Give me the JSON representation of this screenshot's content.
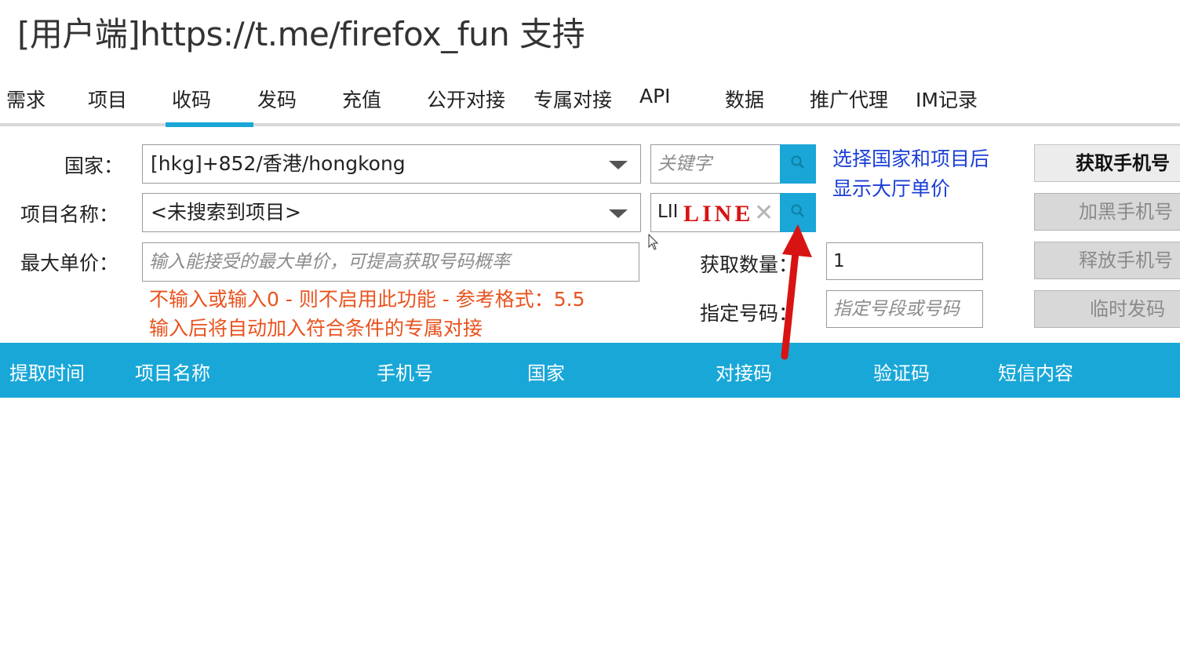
{
  "window": {
    "title": "[用户端]https://t.me/firefox_fun 支持"
  },
  "tabs": [
    {
      "label": "需求"
    },
    {
      "label": "项目"
    },
    {
      "label": "收码",
      "active": true
    },
    {
      "label": "发码"
    },
    {
      "label": "充值"
    },
    {
      "label": "公开对接"
    },
    {
      "label": "专属对接"
    },
    {
      "label": "API"
    },
    {
      "label": "数据"
    },
    {
      "label": "推广代理"
    },
    {
      "label": "IM记录"
    }
  ],
  "form": {
    "country_label": "国家：",
    "country_value": "[hkg]+852/香港/hongkong",
    "country_keyword_placeholder": "关键字",
    "project_label": "项目名称：",
    "project_value": "<未搜索到项目>",
    "project_search_value": "LII",
    "project_search_annotation": "LINE",
    "max_price_label": "最大单价：",
    "max_price_placeholder": "输入能接受的最大单价，可提高获取号码概率",
    "hint_line1": "不输入或输入0 - 则不启用此功能 - 参考格式：5.5",
    "hint_line2": "输入后将自动加入符合条件的专属对接",
    "info_line1": "选择国家和项目后",
    "info_line2": "显示大厅单价",
    "quantity_label": "获取数量：",
    "quantity_value": "1",
    "number_label": "指定号码：",
    "number_placeholder": "指定号段或号码"
  },
  "actions": {
    "get_phone": "获取手机号",
    "blacklist_phone": "加黑手机号",
    "release_phone": "释放手机号",
    "temp_send": "临时发码"
  },
  "table": {
    "columns": [
      "提取时间",
      "项目名称",
      "手机号",
      "国家",
      "对接码",
      "验证码",
      "短信内容"
    ]
  },
  "colors": {
    "accent": "#1aa6d6",
    "header_bg": "#19a7d8",
    "hint_text": "#e8531e",
    "info_text": "#1a3fd6",
    "annotation": "#d81313"
  }
}
